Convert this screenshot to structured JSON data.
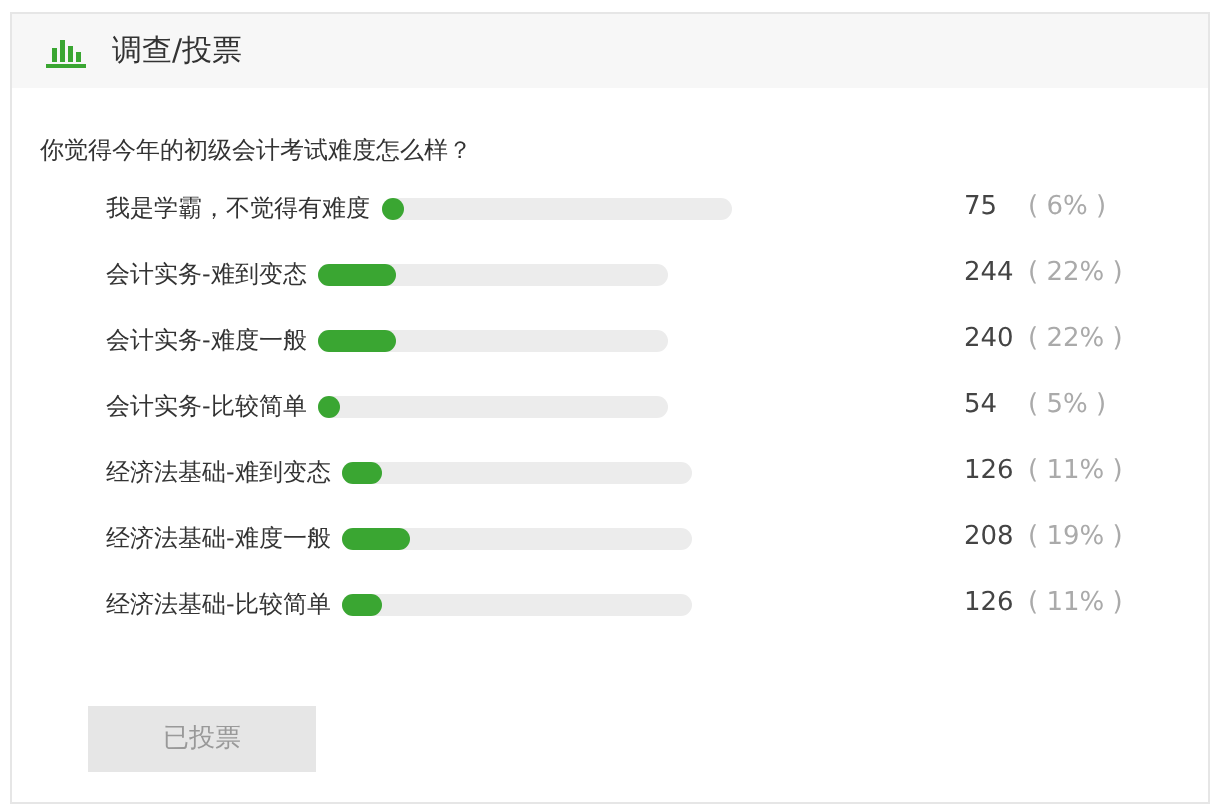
{
  "panel": {
    "title": "调查/投票"
  },
  "question": "你觉得今年的初级会计考试难度怎么样？",
  "options": [
    {
      "label": "我是学霸，不觉得有难度",
      "level": 0.06,
      "count": "75",
      "percent": "( 6% )"
    },
    {
      "label": "会计实务-难到变态",
      "level": 0.22,
      "count": "244",
      "percent": "( 22% )"
    },
    {
      "label": "会计实务-难度一般",
      "level": 0.22,
      "count": "240",
      "percent": "( 22% )"
    },
    {
      "label": "会计实务-比较简单",
      "level": 0.05,
      "count": "54",
      "percent": "( 5% )"
    },
    {
      "label": "经济法基础-难到变态",
      "level": 0.11,
      "count": "126",
      "percent": "( 11% )"
    },
    {
      "label": "经济法基础-难度一般",
      "level": 0.19,
      "count": "208",
      "percent": "( 19% )"
    },
    {
      "label": "经济法基础-比较简单",
      "level": 0.11,
      "count": "126",
      "percent": "( 11% )"
    }
  ],
  "button": {
    "label": "已投票",
    "disabled": true
  }
}
